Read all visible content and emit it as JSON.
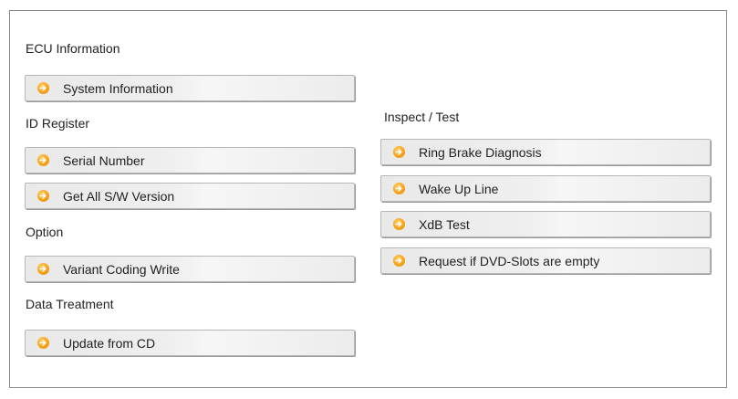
{
  "left": {
    "sections": [
      {
        "title": "ECU Information",
        "buttons": [
          "System Information"
        ]
      },
      {
        "title": "ID Register",
        "buttons": [
          "Serial Number",
          "Get All S/W Version"
        ]
      },
      {
        "title": "Option",
        "buttons": [
          "Variant Coding Write"
        ]
      },
      {
        "title": "Data Treatment",
        "buttons": [
          "Update from CD"
        ]
      }
    ]
  },
  "right": {
    "sections": [
      {
        "title": "Inspect / Test",
        "buttons": [
          "Ring Brake Diagnosis",
          "Wake Up Line",
          "XdB Test",
          "Request if DVD-Slots are empty"
        ]
      }
    ]
  },
  "icon": {
    "name": "arrow-right-circle-icon",
    "color": "#f7a21a"
  }
}
